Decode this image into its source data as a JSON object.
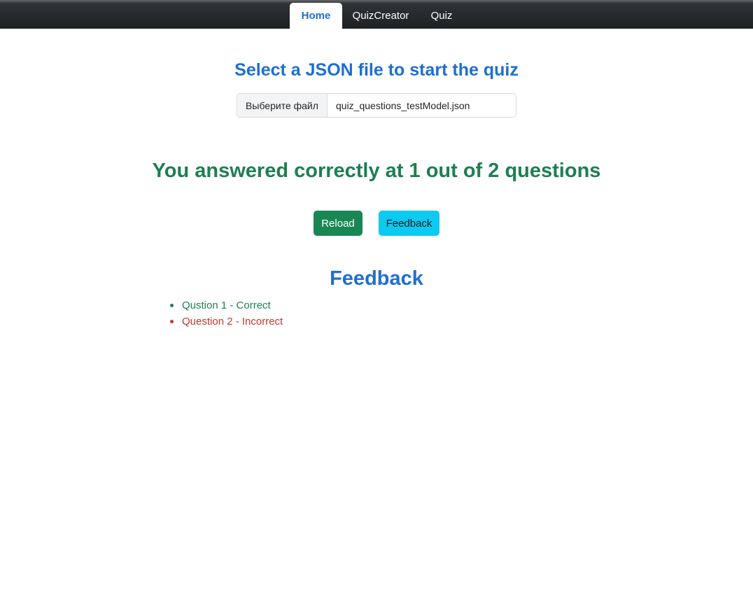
{
  "nav": {
    "tabs": [
      {
        "label": "Home",
        "active": true
      },
      {
        "label": "QuizCreator",
        "active": false
      },
      {
        "label": "Quiz",
        "active": false
      }
    ]
  },
  "file_section": {
    "title": "Select a JSON file to start the quiz",
    "choose_button_label": "Выберите файл",
    "selected_file": "quiz_questions_testModel.json"
  },
  "result": {
    "text": "You answered correctly at 1 out of 2 questions"
  },
  "actions": {
    "reload_label": "Reload",
    "feedback_label": "Feedback"
  },
  "feedback": {
    "title": "Feedback",
    "items": [
      {
        "text": "Qustion 1 - Correct",
        "status": "correct"
      },
      {
        "text": "Question 2 - Incorrect",
        "status": "incorrect"
      }
    ]
  },
  "colors": {
    "accent_blue": "#1d6fd3",
    "success_green": "#1d7f52",
    "reload_button": "#198754",
    "feedback_button": "#0dcaf0",
    "error_red": "#c0392b"
  }
}
